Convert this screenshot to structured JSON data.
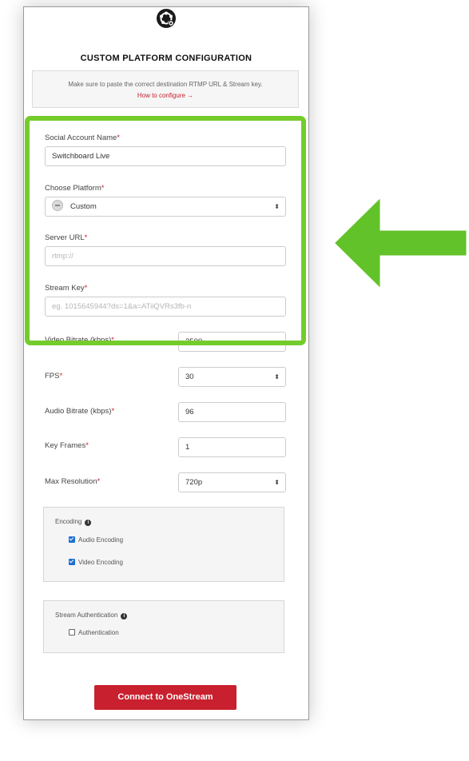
{
  "header": {
    "title": "CUSTOM PLATFORM CONFIGURATION",
    "logo_icon": "onestream-logo-icon"
  },
  "notice": {
    "text": "Make sure to paste the correct destination RTMP URL & Stream key.",
    "link": "How to configure →"
  },
  "form": {
    "social_account_name": {
      "label": "Social Account Name",
      "required": "*",
      "value": "Switchboard Live"
    },
    "choose_platform": {
      "label": "Choose Platform",
      "required": "*",
      "value": "Custom",
      "arrows": "⬍"
    },
    "server_url": {
      "label": "Server URL",
      "required": "*",
      "placeholder": "rtmp://"
    },
    "stream_key": {
      "label": "Stream Key",
      "required": "*",
      "placeholder": "eg. 1015645944?ds=1&a=ATiiQVRs3fb-n"
    },
    "video_bitrate": {
      "label": "Video Bitrate (kbps)",
      "required": "*",
      "value": "2500"
    },
    "fps": {
      "label": "FPS",
      "required": "*",
      "value": "30",
      "arrows": "⬍"
    },
    "audio_bitrate": {
      "label": "Audio Bitrate (kbps)",
      "required": "*",
      "value": "96"
    },
    "key_frames": {
      "label": "Key Frames",
      "required": "*",
      "value": "1"
    },
    "max_resolution": {
      "label": "Max Resolution",
      "required": "*",
      "value": "720p",
      "arrows": "⬍"
    }
  },
  "encoding": {
    "title": "Encoding",
    "info_icon": "i",
    "audio": {
      "label": "Audio Encoding",
      "checked": true
    },
    "video": {
      "label": "Video Encoding",
      "checked": true
    }
  },
  "stream_auth": {
    "title": "Stream Authentication",
    "info_icon": "i",
    "authentication": {
      "label": "Authentication",
      "checked": false
    }
  },
  "connect_button": "Connect to OneStream",
  "annotation": {
    "highlight_color": "#74cc2c",
    "arrow_color": "#62c22a",
    "accent": "#c8202e"
  }
}
